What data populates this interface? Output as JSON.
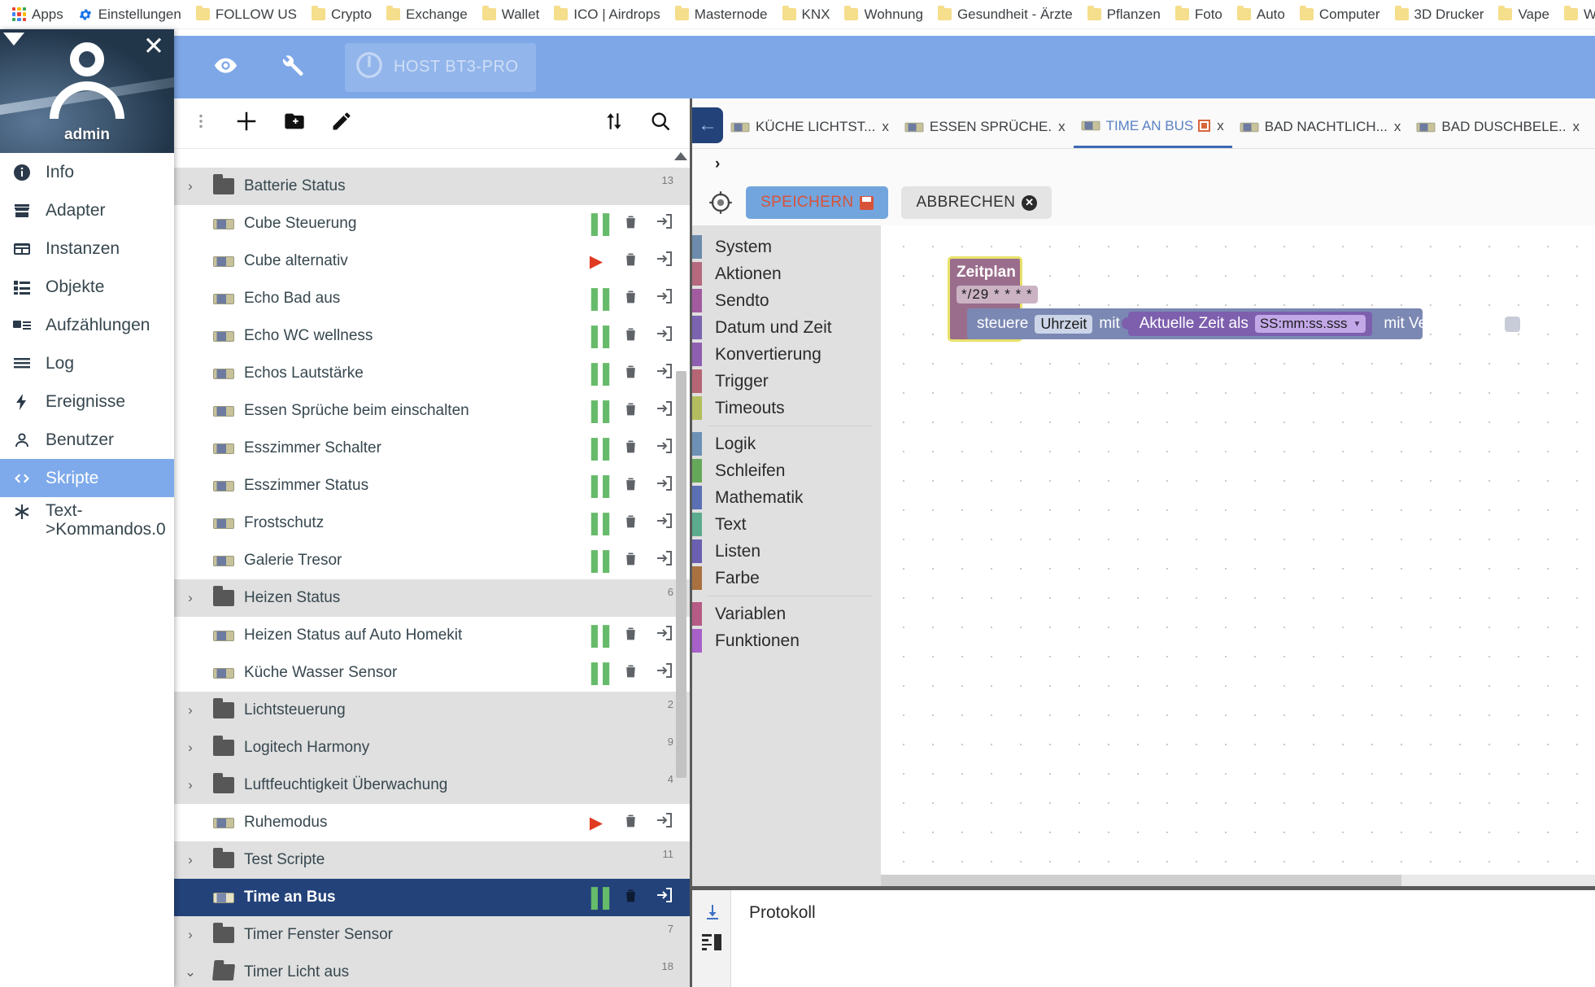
{
  "bookmarks": {
    "apps_label": "Apps",
    "settings_label": "Einstellungen",
    "folders": [
      "FOLLOW US",
      "Crypto",
      "Exchange",
      "Wallet",
      "ICO | Airdrops",
      "Masternode",
      "KNX",
      "Wohnung",
      "Gesundheit - Ärzte",
      "Pflanzen",
      "Foto",
      "Auto",
      "Computer",
      "3D Drucker",
      "Vape",
      "Welto"
    ]
  },
  "sidebar": {
    "user": "admin",
    "items": [
      {
        "label": "Info",
        "icon": "info-icon"
      },
      {
        "label": "Adapter",
        "icon": "store-icon"
      },
      {
        "label": "Instanzen",
        "icon": "instances-icon"
      },
      {
        "label": "Objekte",
        "icon": "list-icon"
      },
      {
        "label": "Aufzählungen",
        "icon": "enum-icon"
      },
      {
        "label": "Log",
        "icon": "lines-icon"
      },
      {
        "label": "Ereignisse",
        "icon": "flash-icon"
      },
      {
        "label": "Benutzer",
        "icon": "person-icon"
      },
      {
        "label": "Skripte",
        "icon": "code-icon"
      },
      {
        "label": "Text-\n>Kommandos.0",
        "icon": "asterisk-icon"
      }
    ],
    "selected_index": 8
  },
  "appbar": {
    "host_label": "HOST BT3-PRO",
    "accent": "#7ea7e8"
  },
  "list_toolbar": {
    "menu": "more-vert-icon",
    "add": "plus-icon",
    "add_folder": "new-folder-icon",
    "edit": "pencil-icon",
    "expand": "expand-collapse-icon",
    "search": "search-icon"
  },
  "script_list": {
    "rows": [
      {
        "type": "script",
        "label": "",
        "state": "partial"
      },
      {
        "type": "folder",
        "label": "Batterie Status",
        "count": "13"
      },
      {
        "type": "script",
        "label": "Cube Steuerung",
        "state": "running"
      },
      {
        "type": "script",
        "label": "Cube alternativ",
        "state": "stopped"
      },
      {
        "type": "script",
        "label": "Echo Bad aus",
        "state": "running"
      },
      {
        "type": "script",
        "label": "Echo WC wellness",
        "state": "running"
      },
      {
        "type": "script",
        "label": "Echos Lautstärke",
        "state": "running"
      },
      {
        "type": "script",
        "label": "Essen Sprüche beim einschalten",
        "state": "running"
      },
      {
        "type": "script",
        "label": "Esszimmer Schalter",
        "state": "running"
      },
      {
        "type": "script",
        "label": "Esszimmer Status",
        "state": "running"
      },
      {
        "type": "script",
        "label": "Frostschutz",
        "state": "running"
      },
      {
        "type": "script",
        "label": "Galerie Tresor",
        "state": "running"
      },
      {
        "type": "folder",
        "label": "Heizen Status",
        "count": "6"
      },
      {
        "type": "script",
        "label": "Heizen Status auf Auto Homekit",
        "state": "running"
      },
      {
        "type": "script",
        "label": "Küche Wasser Sensor",
        "state": "running"
      },
      {
        "type": "folder",
        "label": "Lichtsteuerung",
        "count": "2"
      },
      {
        "type": "folder",
        "label": "Logitech Harmony",
        "count": "9"
      },
      {
        "type": "folder",
        "label": "Luftfeuchtigkeit Überwachung",
        "count": "4"
      },
      {
        "type": "script",
        "label": "Ruhemodus",
        "state": "stopped"
      },
      {
        "type": "folder",
        "label": "Test Scripte",
        "count": "11"
      },
      {
        "type": "script",
        "label": "Time an Bus",
        "state": "running",
        "selected": true
      },
      {
        "type": "folder",
        "label": "Timer Fenster Sensor",
        "count": "7"
      },
      {
        "type": "folder",
        "label": "Timer Licht aus",
        "count": "18",
        "open": true
      }
    ],
    "selected_color": "#23427a",
    "running_color": "#66bb6a",
    "stopped_color": "#e03a21"
  },
  "tabs": {
    "back_icon": "arrow-left-icon",
    "items": [
      {
        "label": "KÜCHE LICHTST...",
        "active": false,
        "modified": false
      },
      {
        "label": "ESSEN SPRÜCHE.",
        "active": false,
        "modified": false
      },
      {
        "label": "TIME AN BUS",
        "active": true,
        "modified": true
      },
      {
        "label": "BAD NACHTLICH...",
        "active": false,
        "modified": false
      },
      {
        "label": "BAD DUSCHBELE..",
        "active": false,
        "modified": false
      }
    ],
    "close_label": "x",
    "active_color": "#5b82c4"
  },
  "subbar": {
    "expand_label": "›"
  },
  "editor_toolbar": {
    "target_icon": "crosshair-icon",
    "save_label": "SPEICHERN",
    "cancel_label": "ABBRECHEN"
  },
  "toolbox": {
    "group1": [
      {
        "label": "System",
        "color": "#6d8cad"
      },
      {
        "label": "Aktionen",
        "color": "#b4697f"
      },
      {
        "label": "Sendto",
        "color": "#a35ba0"
      },
      {
        "label": "Datum und Zeit",
        "color": "#7b63b0"
      },
      {
        "label": "Konvertierung",
        "color": "#8e5fb0"
      },
      {
        "label": "Trigger",
        "color": "#b56574"
      },
      {
        "label": "Timeouts",
        "color": "#b3bd5e"
      }
    ],
    "group2": [
      {
        "label": "Logik",
        "color": "#6d91b5"
      },
      {
        "label": "Schleifen",
        "color": "#66a85a"
      },
      {
        "label": "Mathematik",
        "color": "#5b6fb5"
      },
      {
        "label": "Text",
        "color": "#5bab8e"
      },
      {
        "label": "Listen",
        "color": "#6a5fb0"
      },
      {
        "label": "Farbe",
        "color": "#a9713f"
      }
    ],
    "group3": [
      {
        "label": "Variablen",
        "color": "#b55b85"
      },
      {
        "label": "Funktionen",
        "color": "#a860c9"
      }
    ]
  },
  "block": {
    "title": "Zeitplan",
    "cron": "*/29 * * * *",
    "statement_prefix": "steuere",
    "statement_field": "Uhrzeit",
    "statement_mit": "mit",
    "inner_label": "Aktuelle Zeit als",
    "inner_format": "SS:mm:ss.sss",
    "delay_label": "mit Verzögerung",
    "colors": {
      "schedule": "#9a6d8c",
      "highlight": "#e8e16a",
      "statement": "#7b88b3",
      "inner": "#7d5fae"
    }
  },
  "protocol": {
    "title": "Protokoll",
    "download_icon": "download-icon",
    "layout_icon": "list-layout-icon"
  }
}
